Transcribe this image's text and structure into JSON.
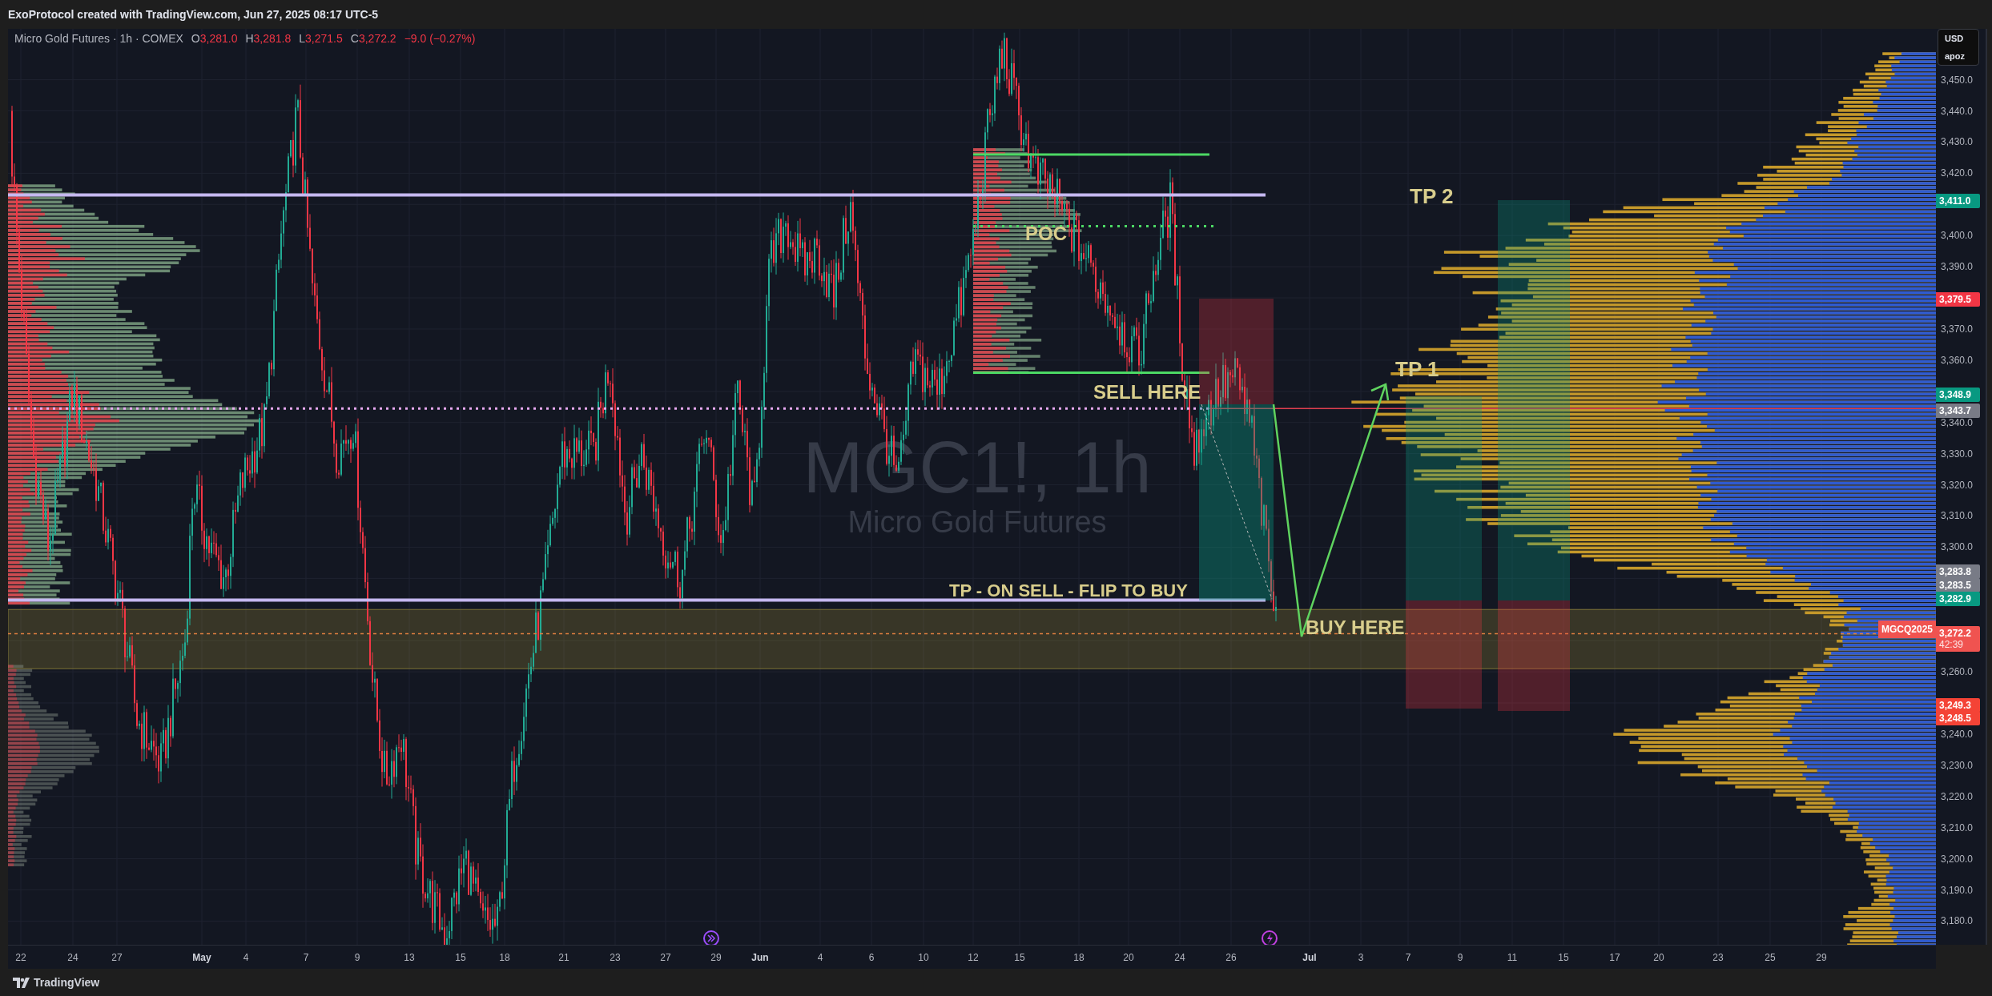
{
  "header": {
    "text": "ExoProtocol created with TradingView.com, Jun 27, 2025 08:17 UTC-5"
  },
  "legend": {
    "symbol": "Micro Gold Futures · 1h · COMEX",
    "values": [
      {
        "key": "O",
        "value": "3,281.0"
      },
      {
        "key": "H",
        "value": "3,281.8"
      },
      {
        "key": "L",
        "value": "3,271.5"
      },
      {
        "key": "C",
        "value": "3,272.2"
      }
    ],
    "change": "−9.0 (−0.27%)"
  },
  "watermark": {
    "symbol": "MGC1!, 1h",
    "description": "Micro Gold Futures"
  },
  "annotations": [
    {
      "text": "TP 2"
    },
    {
      "text": "POC"
    },
    {
      "text": "TP 1"
    },
    {
      "text": "SELL HERE"
    },
    {
      "text": "TP - ON SELL - FLIP TO BUY"
    },
    {
      "text": "BUY HERE"
    }
  ],
  "symbol_tag": {
    "text": "MGCQ2025"
  },
  "price_axis": {
    "currency": "USD",
    "unit": "apoz",
    "ticks": [
      "3,450.0",
      "3,440.0",
      "3,430.0",
      "3,420.0",
      "3,400.0",
      "3,390.0",
      "3,370.0",
      "3,360.0",
      "3,340.0",
      "3,330.0",
      "3,320.0",
      "3,310.0",
      "3,300.0",
      "3,260.0",
      "3,240.0",
      "3,230.0",
      "3,220.0",
      "3,210.0",
      "3,200.0",
      "3,190.0",
      "3,180.0"
    ],
    "tags": [
      {
        "text": "3,411.0",
        "color": "#089981"
      },
      {
        "text": "3,379.5",
        "color": "#f23645"
      },
      {
        "text": "3,348.9",
        "color": "#089981"
      },
      {
        "text": "3,343.7",
        "color": "#787b86"
      },
      {
        "text": "3,283.8",
        "color": "#787b86"
      },
      {
        "text": "3,283.5",
        "color": "#787b86"
      },
      {
        "text": "3,282.9",
        "color": "#089981"
      },
      {
        "text": "3,272.2",
        "sub": "42:39",
        "color": "#f05350"
      },
      {
        "text": "3,249.3",
        "color": "#f44336"
      },
      {
        "text": "3,248.5",
        "color": "#f44336"
      }
    ]
  },
  "time_axis": {
    "labels": [
      {
        "text": "22",
        "kind": "day"
      },
      {
        "text": "24",
        "kind": "day"
      },
      {
        "text": "27",
        "kind": "day"
      },
      {
        "text": "May",
        "kind": "month"
      },
      {
        "text": "4",
        "kind": "day"
      },
      {
        "text": "7",
        "kind": "day"
      },
      {
        "text": "9",
        "kind": "day"
      },
      {
        "text": "13",
        "kind": "day"
      },
      {
        "text": "15",
        "kind": "day"
      },
      {
        "text": "18",
        "kind": "day"
      },
      {
        "text": "21",
        "kind": "day"
      },
      {
        "text": "23",
        "kind": "day"
      },
      {
        "text": "27",
        "kind": "day"
      },
      {
        "text": "29",
        "kind": "day"
      },
      {
        "text": "Jun",
        "kind": "month"
      },
      {
        "text": "4",
        "kind": "day"
      },
      {
        "text": "6",
        "kind": "day"
      },
      {
        "text": "10",
        "kind": "day"
      },
      {
        "text": "12",
        "kind": "day"
      },
      {
        "text": "15",
        "kind": "day"
      },
      {
        "text": "18",
        "kind": "day"
      },
      {
        "text": "20",
        "kind": "day"
      },
      {
        "text": "24",
        "kind": "day"
      },
      {
        "text": "26",
        "kind": "day"
      },
      {
        "text": "Jul",
        "kind": "month"
      },
      {
        "text": "3",
        "kind": "day"
      },
      {
        "text": "7",
        "kind": "day"
      },
      {
        "text": "9",
        "kind": "day"
      },
      {
        "text": "11",
        "kind": "day"
      },
      {
        "text": "15",
        "kind": "day"
      },
      {
        "text": "17",
        "kind": "day"
      },
      {
        "text": "20",
        "kind": "day"
      },
      {
        "text": "23",
        "kind": "day"
      },
      {
        "text": "25",
        "kind": "day"
      },
      {
        "text": "29",
        "kind": "day"
      }
    ]
  },
  "footer": {
    "brand": "TradingView"
  }
}
